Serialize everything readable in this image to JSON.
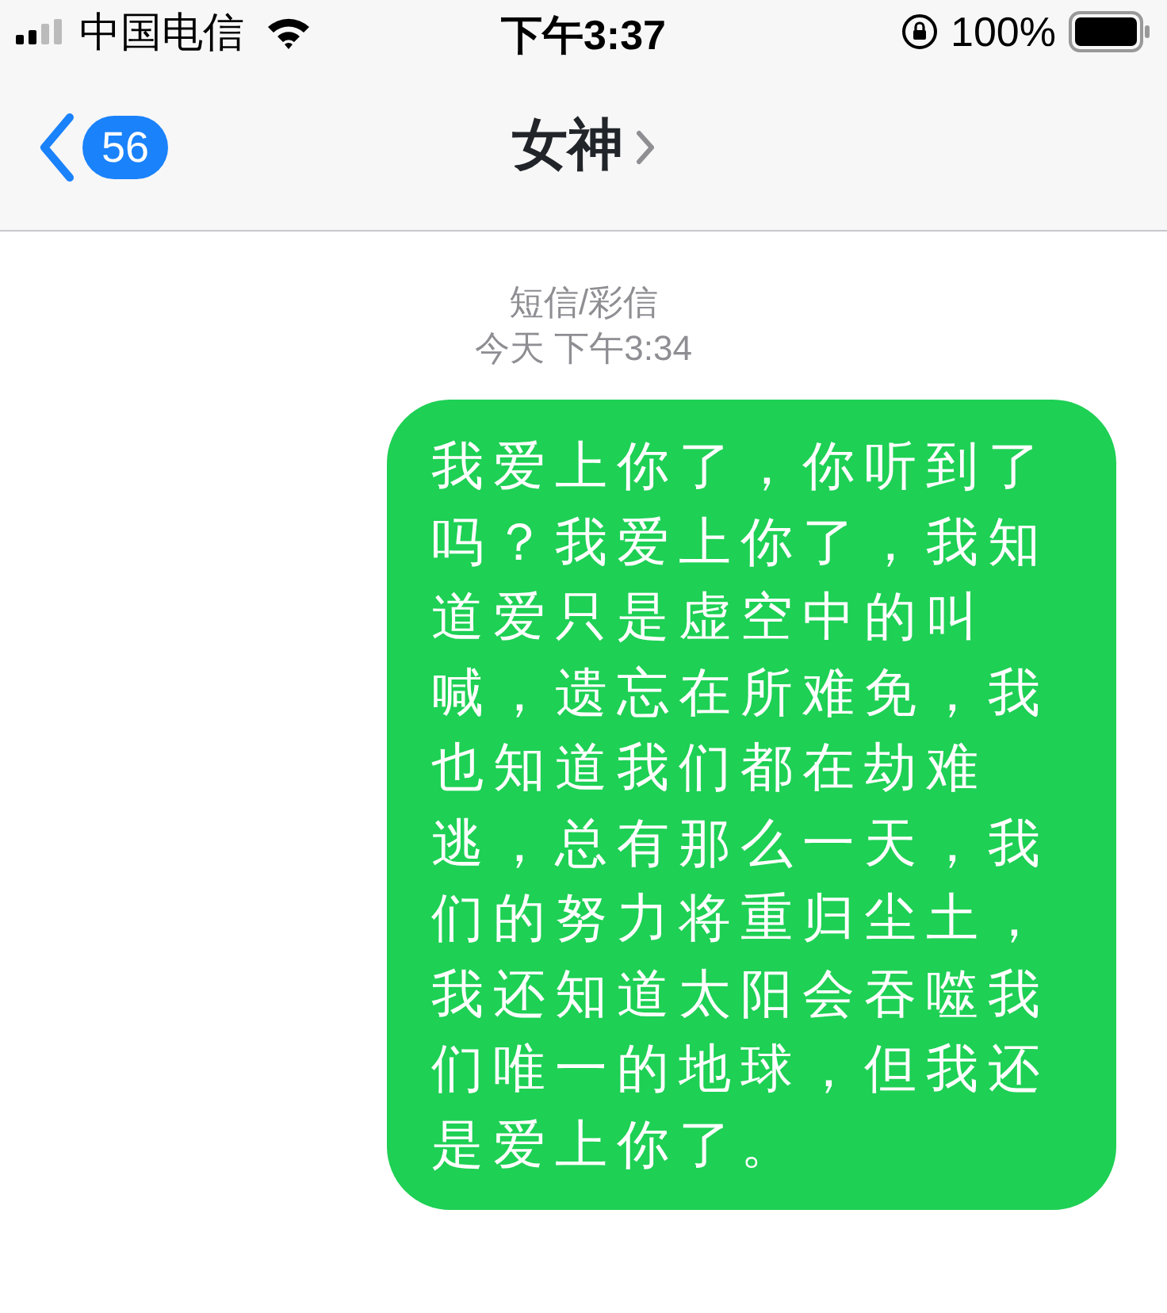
{
  "status_bar": {
    "carrier": "中国电信",
    "time": "下午3:37",
    "battery": "100%"
  },
  "nav": {
    "back_count": "56",
    "title": "女神"
  },
  "conversation": {
    "service": "短信/彩信",
    "timestamp": "今天 下午3:34"
  },
  "messages": [
    {
      "text": "我爱上你了，你听到了吗？我爱上你了，我知道爱只是虚空中的叫喊，遗忘在所难免，我也知道我们都在劫难逃，总有那么一天，我们的努力将重归尘土，我还知道太阳会吞噬我们唯一的地球，但我还是爱上你了。",
      "outgoing": true
    }
  ]
}
